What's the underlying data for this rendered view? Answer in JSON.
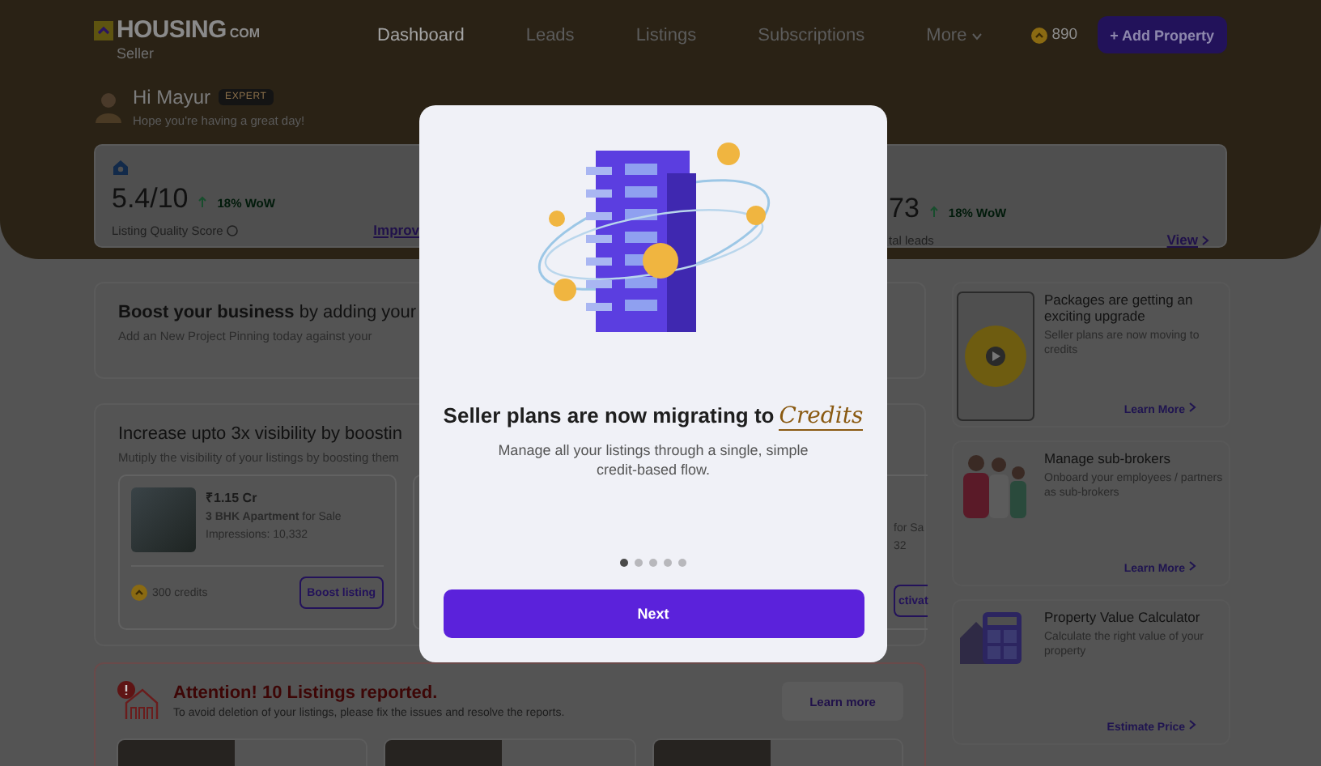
{
  "header": {
    "logo_main": "HOUSING",
    "logo_sub": "COM",
    "role": "Seller",
    "nav": [
      {
        "label": "Dashboard",
        "selected": true
      },
      {
        "label": "Leads",
        "selected": false
      },
      {
        "label": "Listings",
        "selected": false
      },
      {
        "label": "Subscriptions",
        "selected": false
      },
      {
        "label": "More",
        "selected": false
      }
    ],
    "credits": "890",
    "add_button": "+ Add Property"
  },
  "greeting": {
    "name": "Hi Mayur",
    "badge": "EXPERT",
    "message": "Hope you're having a great day!"
  },
  "stats": {
    "left": {
      "value": "5.4/10",
      "change": "18% WoW",
      "label": "Listing Quality Score",
      "link": "Improv"
    },
    "right": {
      "value": "73",
      "change": "18% WoW",
      "label": "tal leads",
      "link": "View"
    }
  },
  "boost_business": {
    "title": "**Boost your business** by adding your",
    "text": "Add an New Project Pinning today against your"
  },
  "boost_visibility": {
    "title": "Increase upto 3x visibility by boostin",
    "text": "Mutiply the visibility of your listings by boosting them",
    "listing": {
      "price": "₹1.15 Cr",
      "type": "**3 BHK Apartment** for Sale",
      "impressions": "Impressions: 10,332",
      "credits": "300 credits",
      "button": "Boost listing"
    },
    "listing_partial": {
      "type": "for Sa",
      "impressions": "32",
      "button": "ctivat"
    }
  },
  "alert": {
    "title": "Attention! 10 Listings reported.",
    "text": "To avoid deletion of your listings, please fix the issues and resolve the reports.",
    "button": "Learn more"
  },
  "side_cards": [
    {
      "kind": "coin",
      "title": "Packages are getting an exciting upgrade",
      "text": "Seller plans are now moving to credits",
      "link": "Learn More"
    },
    {
      "kind": "people",
      "title": "Manage sub-brokers",
      "text": "Onboard your employees / partners as sub-brokers",
      "link": "Learn More"
    },
    {
      "kind": "calculator",
      "title": "Property Value Calculator",
      "text": "Calculate the right value of your property",
      "link": "Estimate Price"
    }
  ],
  "modal": {
    "title": "Seller plans are now migrating to",
    "title_accent": "Credits",
    "text": "Manage all your listings through a single, simple credit-based flow.",
    "dots": [
      {
        "selected": true
      },
      {
        "selected": false
      },
      {
        "selected": false
      },
      {
        "selected": false
      },
      {
        "selected": false
      }
    ],
    "button": "Next"
  }
}
